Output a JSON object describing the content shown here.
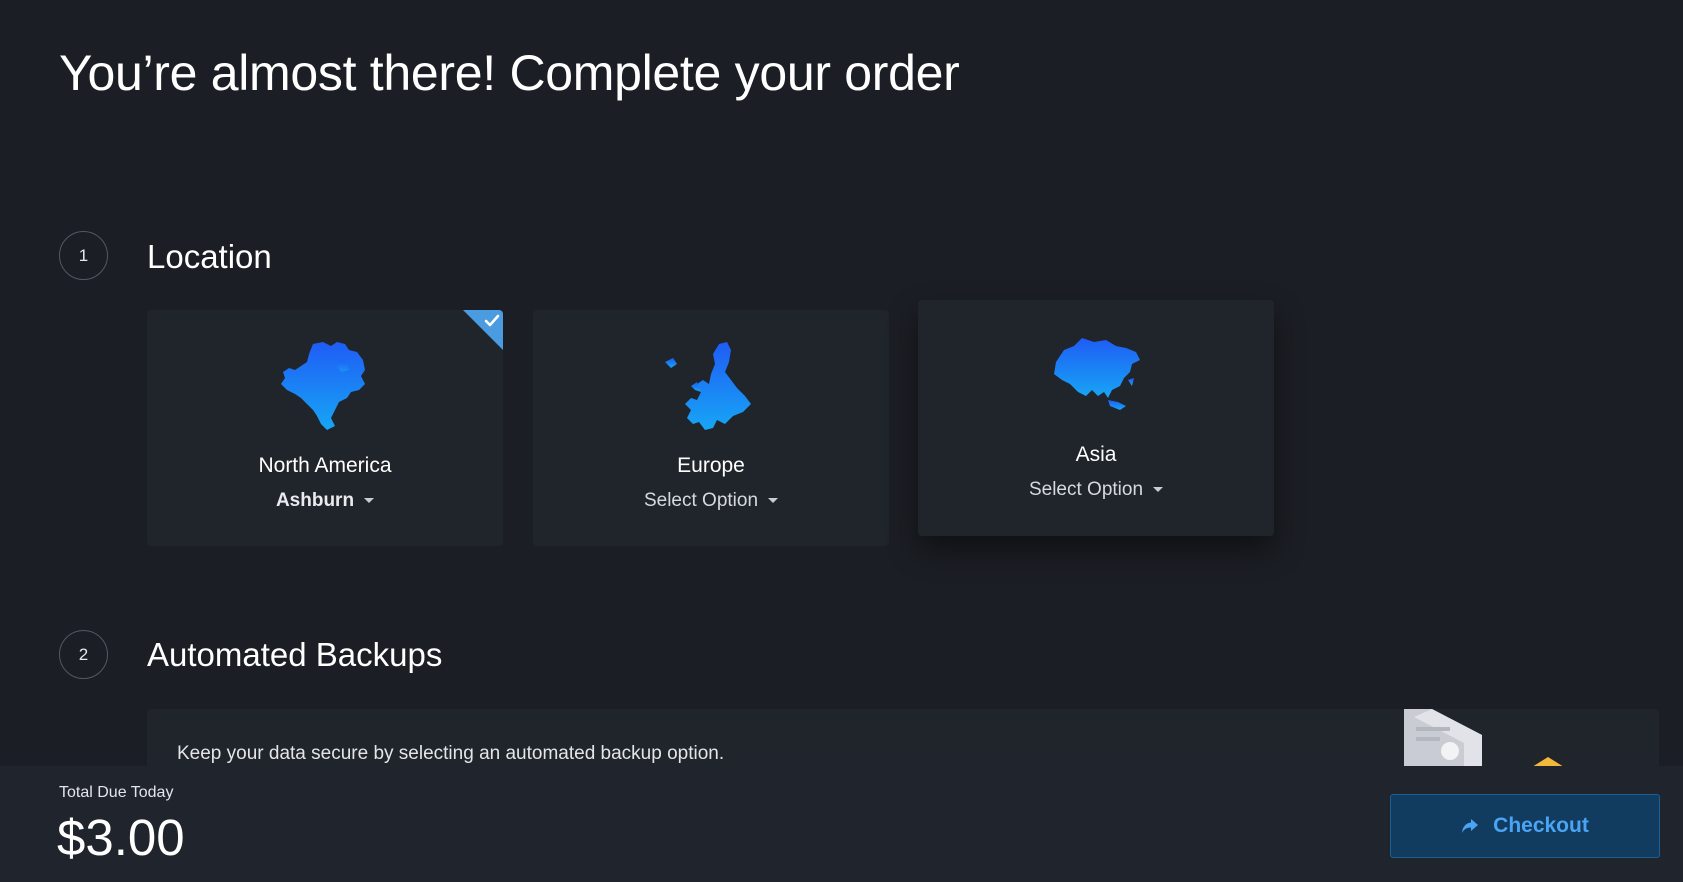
{
  "page": {
    "title": "You’re almost there! Complete your order"
  },
  "sections": [
    {
      "number": "1",
      "title": "Location"
    },
    {
      "number": "2",
      "title": "Automated Backups"
    }
  ],
  "locations": [
    {
      "region": "North America",
      "option": "Ashburn",
      "selected": true,
      "icon": "north-america-map-icon"
    },
    {
      "region": "Europe",
      "option": "Select Option",
      "selected": false,
      "icon": "europe-map-icon"
    },
    {
      "region": "Asia",
      "option": "Select Option",
      "selected": false,
      "icon": "asia-map-icon"
    }
  ],
  "backups": {
    "description": "Keep your data secure by selecting an automated backup option."
  },
  "footer": {
    "total_label": "Total Due Today",
    "total_amount": "$3.00",
    "checkout_label": "Checkout",
    "checkout_icon": "share-arrow-icon"
  },
  "colors": {
    "background": "#1b1e24",
    "card": "#20242b",
    "accent": "#4a9be0",
    "map_gradient_top": "#1f5cf5",
    "map_gradient_bottom": "#17a6f5",
    "checkout_bg": "#123c5f",
    "checkout_text": "#4aa3f3"
  }
}
